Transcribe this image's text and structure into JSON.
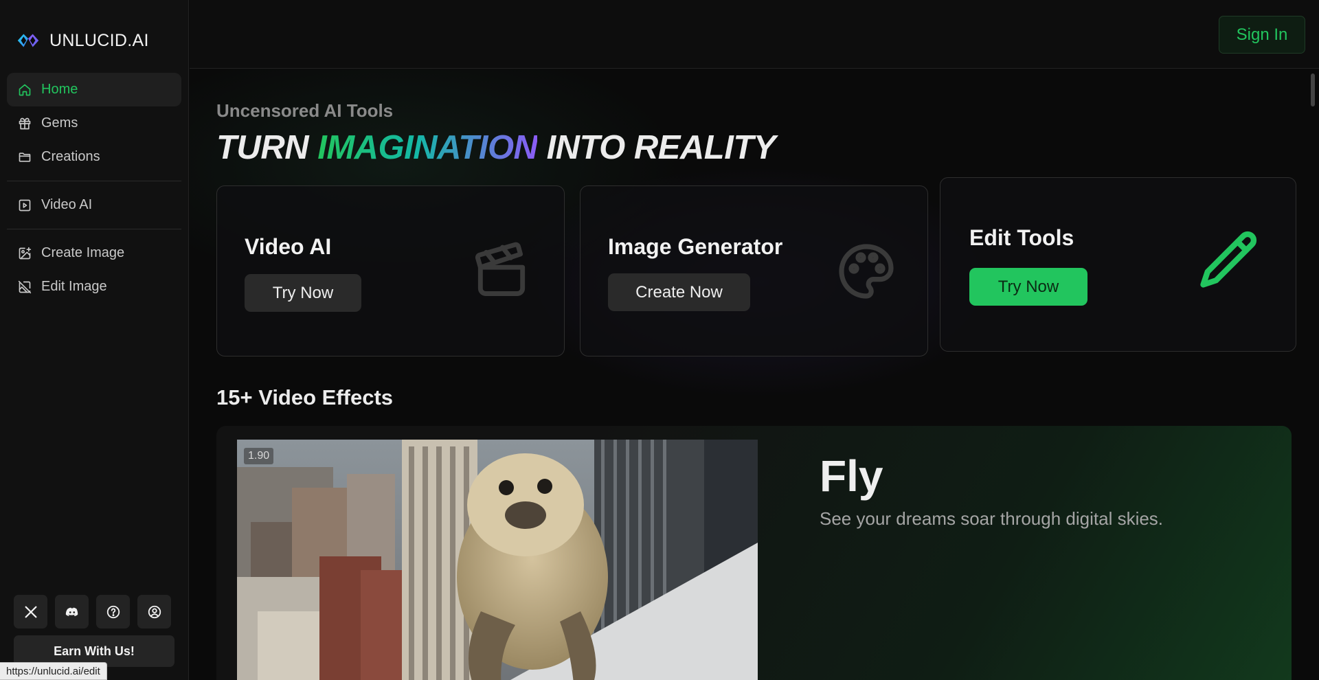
{
  "brand": {
    "name": "UNLUCID.AI"
  },
  "sidebar": {
    "items": [
      {
        "label": "Home",
        "icon": "home-icon",
        "active": true
      },
      {
        "label": "Gems",
        "icon": "gift-icon"
      },
      {
        "label": "Creations",
        "icon": "folder-icon"
      },
      {
        "label": "Video AI",
        "icon": "video-icon"
      },
      {
        "label": "Create Image",
        "icon": "image-plus-icon"
      },
      {
        "label": "Edit Image",
        "icon": "image-off-icon"
      }
    ],
    "social": [
      "x-icon",
      "discord-icon",
      "help-icon",
      "user-circle-icon"
    ],
    "earn_label": "Earn With Us!"
  },
  "header": {
    "signin_label": "Sign In"
  },
  "hero": {
    "eyebrow": "Uncensored AI Tools",
    "headline_pre": "TURN ",
    "headline_highlight": "IMAGINATION",
    "headline_post": " INTO REALITY"
  },
  "tools": [
    {
      "title": "Video AI",
      "button": "Try Now",
      "icon": "clapperboard-icon"
    },
    {
      "title": "Image Generator",
      "button": "Create Now",
      "icon": "palette-icon"
    },
    {
      "title": "Edit Tools",
      "button": "Try Now",
      "icon": "pencil-icon"
    }
  ],
  "effects": {
    "section_title": "15+ Video Effects",
    "items": [
      {
        "title": "Fly",
        "description": "See your dreams soar through digital skies.",
        "badge": "1.90"
      }
    ]
  },
  "status_url": "https://unlucid.ai/edit",
  "colors": {
    "accent": "#22c55e",
    "background": "#0a0a0a",
    "sidebar": "#111111"
  }
}
